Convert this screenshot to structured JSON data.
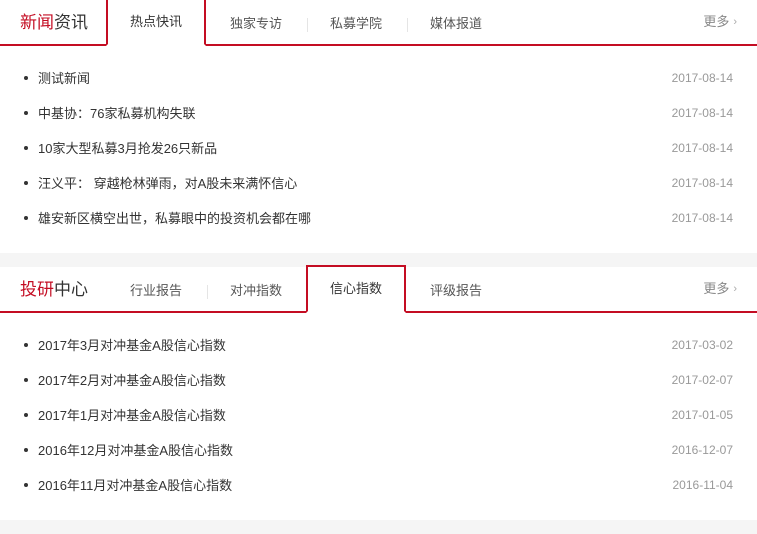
{
  "sections": [
    {
      "title_accent": "新闻",
      "title_plain": "资讯",
      "more_label": "更多",
      "active_tab": 0,
      "tabs": [
        "热点快讯",
        "独家专访",
        "私募学院",
        "媒体报道"
      ],
      "items": [
        {
          "title": "测试新闻",
          "date": "2017-08-14"
        },
        {
          "title": "中基协：76家私募机构失联",
          "date": "2017-08-14"
        },
        {
          "title": "10家大型私募3月抢发26只新品",
          "date": "2017-08-14"
        },
        {
          "title": "汪义平： 穿越枪林弹雨，对A股未来满怀信心",
          "date": "2017-08-14"
        },
        {
          "title": "雄安新区横空出世，私募眼中的投资机会都在哪",
          "date": "2017-08-14"
        }
      ]
    },
    {
      "title_accent": "投研",
      "title_plain": "中心",
      "more_label": "更多",
      "active_tab": 2,
      "tabs": [
        "行业报告",
        "对冲指数",
        "信心指数",
        "评级报告"
      ],
      "items": [
        {
          "title": "2017年3月对冲基金A股信心指数",
          "date": "2017-03-02"
        },
        {
          "title": "2017年2月对冲基金A股信心指数",
          "date": "2017-02-07"
        },
        {
          "title": "2017年1月对冲基金A股信心指数",
          "date": "2017-01-05"
        },
        {
          "title": "2016年12月对冲基金A股信心指数",
          "date": "2016-12-07"
        },
        {
          "title": "2016年11月对冲基金A股信心指数",
          "date": "2016-11-04"
        }
      ]
    }
  ]
}
